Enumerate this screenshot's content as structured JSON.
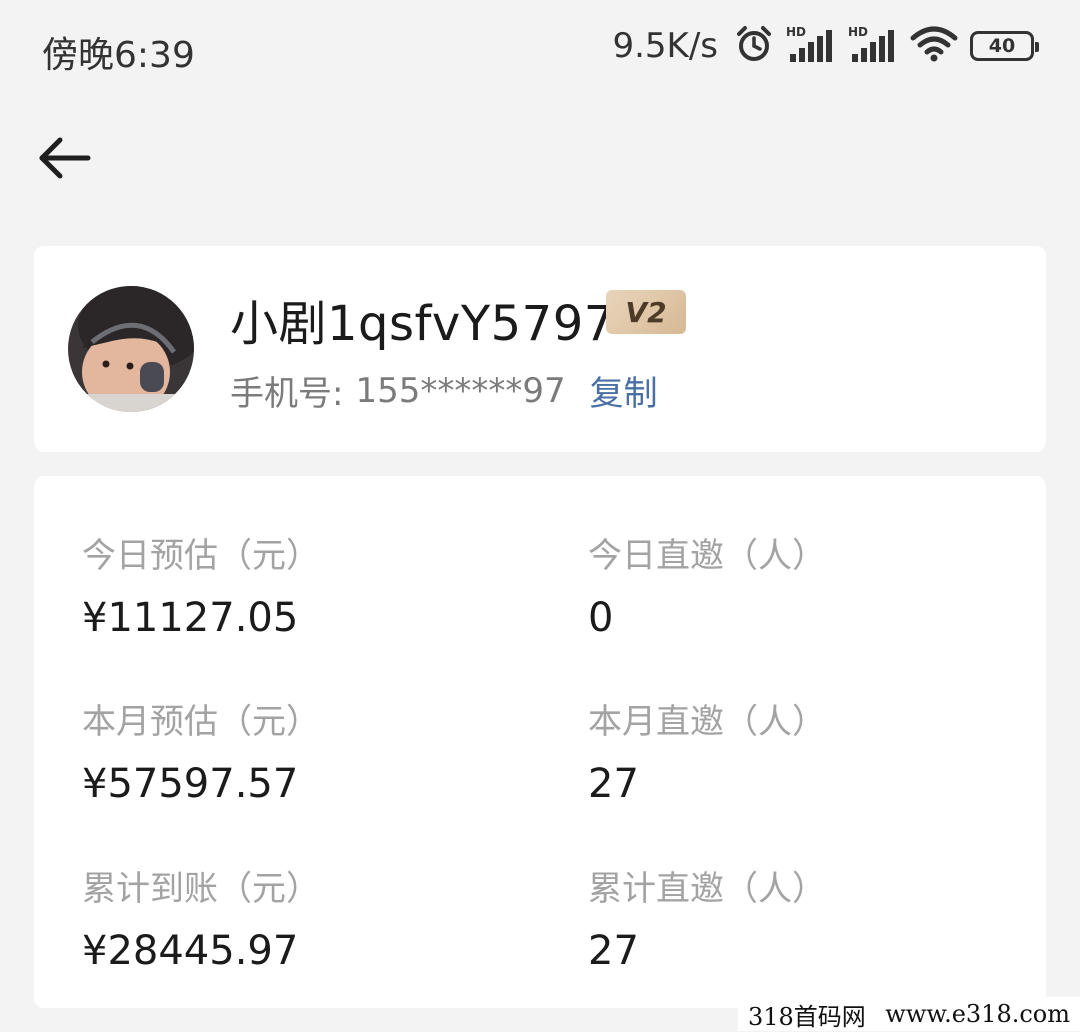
{
  "status_bar": {
    "time": "傍晚6:39",
    "net_speed": "9.5K/s",
    "icons": [
      "alarm-icon",
      "hd-signal-icon",
      "hd-signal-icon",
      "wifi-icon"
    ],
    "battery": "40"
  },
  "nav": {
    "back_icon": "arrow-left-icon"
  },
  "profile": {
    "name": "小剧1qsfvY5797",
    "vip_level": "V2",
    "phone_label": "手机号:",
    "phone_value": "155******97",
    "copy_label": "复制",
    "copy_color": "#4a6fa5"
  },
  "stats": [
    {
      "label": "今日预估（元）",
      "value": "¥11127.05"
    },
    {
      "label": "今日直邀（人）",
      "value": "0"
    },
    {
      "label": "本月预估（元）",
      "value": "¥57597.57"
    },
    {
      "label": "本月直邀（人）",
      "value": "27"
    },
    {
      "label": "累计到账（元）",
      "value": "¥28445.97"
    },
    {
      "label": "累计直邀（人）",
      "value": "27"
    }
  ],
  "watermark": {
    "left": "318首码网",
    "right": "www.e318.com"
  }
}
